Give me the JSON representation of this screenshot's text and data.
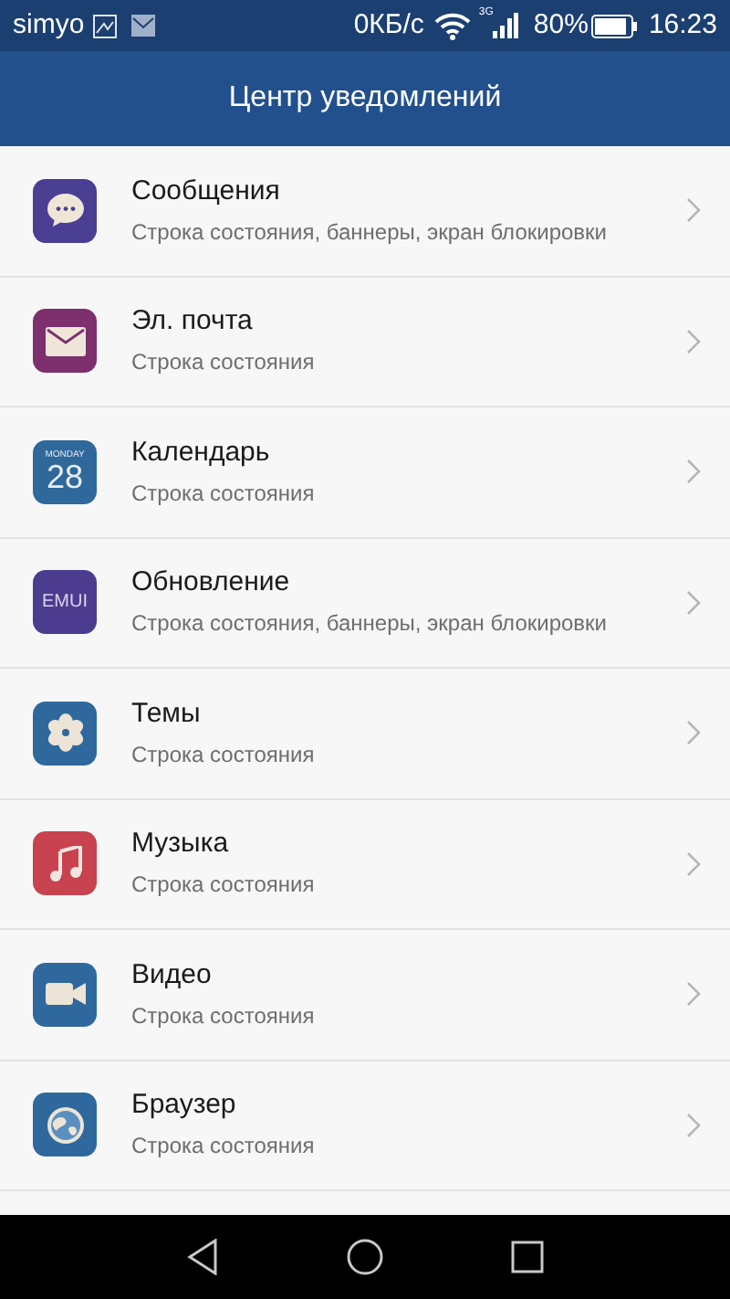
{
  "status_bar": {
    "carrier": "simyo",
    "speed": "0КБ/с",
    "network": "3G",
    "battery": "80%",
    "time": "16:23"
  },
  "title": "Центр уведомлений",
  "apps": [
    {
      "kind": "messages",
      "name": "Сообщения",
      "subtitle": "Строка состояния, баннеры, экран блокировки"
    },
    {
      "kind": "mail",
      "name": "Эл. почта",
      "subtitle": "Строка состояния"
    },
    {
      "kind": "calendar",
      "name": "Календарь",
      "subtitle": "Строка состояния",
      "icon_day": "MONDAY",
      "icon_date": "28"
    },
    {
      "kind": "update",
      "name": "Обновление",
      "subtitle": "Строка состояния, баннеры, экран блокировки",
      "icon_text": "EMUI"
    },
    {
      "kind": "themes",
      "name": "Темы",
      "subtitle": "Строка состояния"
    },
    {
      "kind": "music",
      "name": "Музыка",
      "subtitle": "Строка состояния"
    },
    {
      "kind": "video",
      "name": "Видео",
      "subtitle": "Строка состояния"
    },
    {
      "kind": "browser",
      "name": "Браузер",
      "subtitle": "Строка состояния"
    }
  ]
}
